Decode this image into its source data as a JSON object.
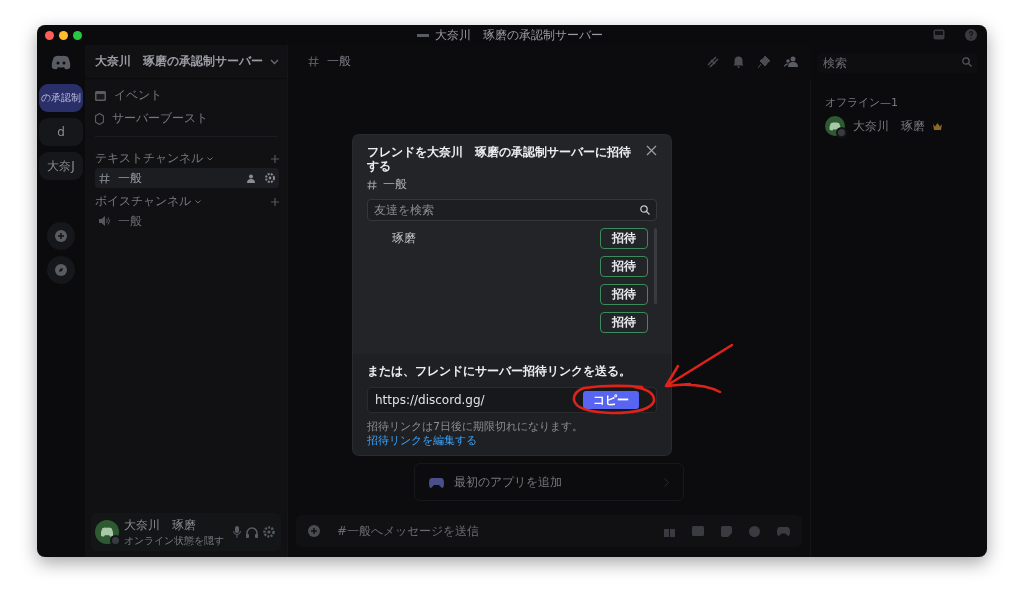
{
  "window": {
    "title": "大奈川　琢磨の承認制サーバー"
  },
  "servers": [
    {
      "label": "の承認制",
      "selected": true
    },
    {
      "label": "d",
      "selected": false
    },
    {
      "label": "大奈J",
      "selected": false
    }
  ],
  "server_name": "大奈川　琢磨の承認制サーバー",
  "sidebar": {
    "links": [
      {
        "kind": "event",
        "label": "イベント"
      },
      {
        "kind": "boost",
        "label": "サーバーブースト"
      }
    ],
    "categories": [
      {
        "kind": "text",
        "label": "テキストチャンネル",
        "channels": [
          {
            "name": "一般",
            "selected": true
          }
        ]
      },
      {
        "kind": "voice",
        "label": "ボイスチャンネル",
        "channels": [
          {
            "name": "一般",
            "selected": false
          }
        ]
      }
    ]
  },
  "user_panel": {
    "name": "大奈川　琢磨",
    "status": "オンライン状態を隠す"
  },
  "channel_header": {
    "name": "一般"
  },
  "search": {
    "placeholder": "検索"
  },
  "members": {
    "heading": "オフライン—1",
    "items": [
      {
        "name": "大奈川　琢磨"
      }
    ]
  },
  "app_card": {
    "label": "最初のアプリを追加"
  },
  "composer": {
    "placeholder": "#一般へメッセージを送信"
  },
  "modal": {
    "title": "フレンドを大奈川　琢磨の承認制サーバーに招待する",
    "channel": "一般",
    "search_placeholder": "友達を検索",
    "friends": [
      {
        "name": "琢磨",
        "button": "招待"
      },
      {
        "button": "招待"
      },
      {
        "button": "招待"
      },
      {
        "button": "招待"
      }
    ],
    "link_heading": "または、フレンドにサーバー招待リンクを送る。",
    "link": "https://discord.gg/",
    "copy": "コピー",
    "expiry": "招待リンクは7日後に期限切れになります。",
    "edit_link": "招待リンクを編集する"
  }
}
